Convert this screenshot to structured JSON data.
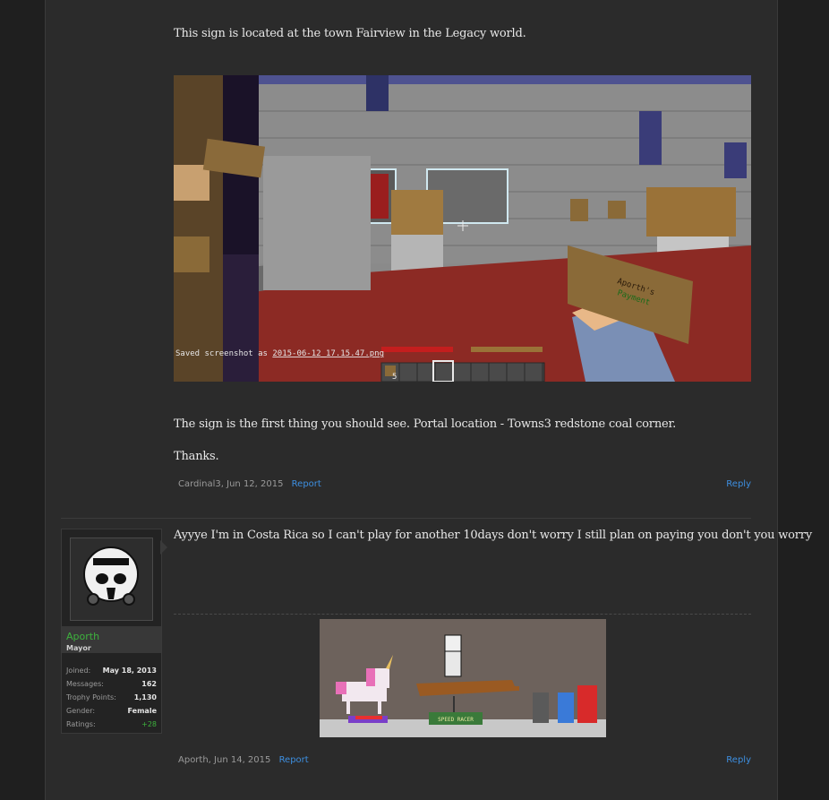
{
  "post1": {
    "text_1": "This sign is located at the town Fairview in the Legacy world.",
    "screenshot": {
      "hud_message_prefix": "Saved screenshot as ",
      "hud_message_file": "2015-06-12_17.15.47.png",
      "hotbar_count": "5",
      "sign_lines": [
        "Aporth's",
        "Payment"
      ]
    },
    "text_2": "The sign is the first thing you should see. Portal location - Towns3 redstone coal corner.",
    "text_3": "Thanks.",
    "meta_author_date": "Cardinal3, Jun 12, 2015",
    "report_label": "Report",
    "reply_label": "Reply"
  },
  "post2": {
    "user": {
      "name": "Aporth",
      "title": "Mayor",
      "stats": [
        {
          "key": "Joined:",
          "value": "May 18, 2013"
        },
        {
          "key": "Messages:",
          "value": "162"
        },
        {
          "key": "Trophy Points:",
          "value": "1,130"
        },
        {
          "key": "Gender:",
          "value": "Female"
        },
        {
          "key": "Ratings:",
          "value": "+28"
        }
      ]
    },
    "text_1": "Ayyye I'm in Costa Rica so I can't play for another 10days don't worry I still plan on paying you don't you worry",
    "art": {
      "sign_text": "SPEED RACER"
    },
    "meta_author_date": "Aporth, Jun 14, 2015",
    "report_label": "Report",
    "reply_label": "Reply"
  },
  "colors": {
    "page_bg": "#2b2b2b",
    "text": "#e8e8e8",
    "link": "#3d8fe0",
    "username": "#3db23d"
  }
}
